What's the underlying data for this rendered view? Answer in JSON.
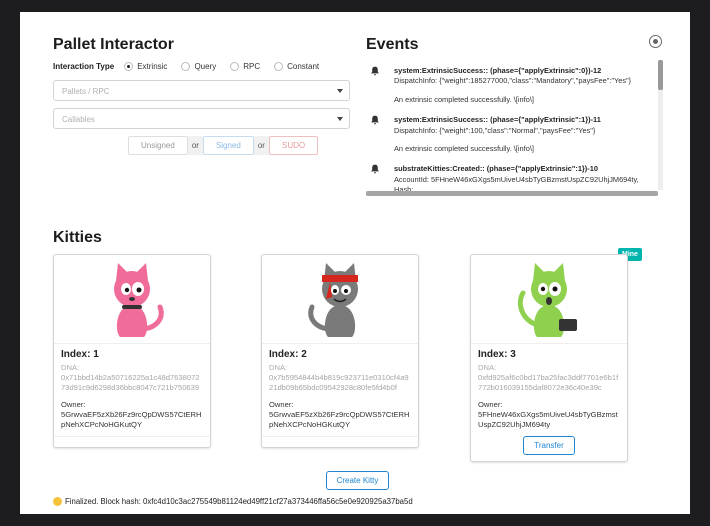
{
  "pallet": {
    "title": "Pallet Interactor",
    "interaction_label": "Interaction Type",
    "options": [
      "Extrinsic",
      "Query",
      "RPC",
      "Constant"
    ],
    "selected": "Extrinsic",
    "pallets_placeholder": "Pallets / RPC",
    "callables_placeholder": "Callables",
    "tx": {
      "unsigned": "Unsigned",
      "or1": "or",
      "signed": "Signed",
      "or2": "or",
      "sudo": "SUDO"
    }
  },
  "events": {
    "title": "Events",
    "items": [
      {
        "title": "system:ExtrinsicSuccess:: (phase={\"applyExtrinsic\":0})-12",
        "line1": "DispatchInfo: {\"weight\":185277000,\"class\":\"Mandatory\",\"paysFee\":\"Yes\"}",
        "line2": "An extrinsic completed successfully. \\[info\\]"
      },
      {
        "title": "system:ExtrinsicSuccess:: (phase={\"applyExtrinsic\":1})-11",
        "line1": "DispatchInfo: {\"weight\":100,\"class\":\"Normal\",\"paysFee\":\"Yes\"}",
        "line2": "An extrinsic completed successfully. \\[info\\]"
      },
      {
        "title": "substrateKitties:Created:: (phase={\"applyExtrinsic\":1})-10",
        "line1": "AccountId: 5FHneW46xGXgs5mUiveU4sbTyGBzmstUspZC92UhjJM694ty,",
        "line2": "Hash:",
        "line3": "0xfd925af6c0bd17ba25fac3ddf7701e6b1f772b016039155daf8072e36c40e39c"
      }
    ]
  },
  "kitties": {
    "title": "Kitties",
    "mine_label": "Mine",
    "dna_label": "DNA:",
    "owner_label": "Owner:",
    "items": [
      {
        "index": "Index: 1",
        "dna": "0x71bbd14b2a50716225a1c48d763807273d91c9d6298d36bbc8047c721b750639",
        "owner": "5GrwvaEF5zXb26Fz9rcQpDWS57CtERHpNehXCPcNoHGKutQY",
        "color": "#f06c9b"
      },
      {
        "index": "Index: 2",
        "dna": "0x7b5954844b4b819c923711e0310cf4a921db09b65bdc09542928c80fe5fd4b0f",
        "owner": "5GrwvaEF5zXb26Fz9rcQpDWS57CtERHpNehXCPcNoHGKutQY",
        "color": "#7a7a7a"
      },
      {
        "index": "Index: 3",
        "dna": "0xfd925af6c0bd17ba25fac3ddf7701e6b1f772b016039155daf8072e36c40e39c",
        "owner": "5FHneW46xGXgs5mUiveU4sbTyGBzmstUspZC92UhjJM694ty",
        "color": "#8fd14f",
        "transfer": "Transfer"
      }
    ]
  },
  "create_label": "Create Kitty",
  "status": "Finalized. Block hash: 0xfc4d10c3ac275549b81124ed49ff21cf27a373446ffa56c5e0e920925a37ba5d"
}
